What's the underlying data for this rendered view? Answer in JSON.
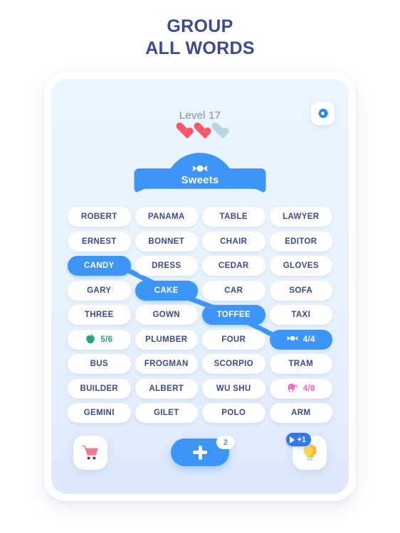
{
  "page": {
    "title_line1": "GROUP",
    "title_line2": "ALL WORDS",
    "title_color": "#3e4a89"
  },
  "header": {
    "level_label": "Level 17",
    "lives_total": 3,
    "lives_remaining": 2,
    "heart_full_color": "#f8566a",
    "heart_empty_color": "#b6d7e2",
    "settings_icon": "gear-icon"
  },
  "banner": {
    "category": "Sweets",
    "icon": "candy-icon",
    "color": "#3d95f7"
  },
  "grid": {
    "rows": [
      [
        {
          "label": "ROBERT",
          "type": "word",
          "selected": false
        },
        {
          "label": "PANAMA",
          "type": "word",
          "selected": false
        },
        {
          "label": "TABLE",
          "type": "word",
          "selected": false
        },
        {
          "label": "LAWYER",
          "type": "word",
          "selected": false
        }
      ],
      [
        {
          "label": "ERNEST",
          "type": "word",
          "selected": false
        },
        {
          "label": "BONNET",
          "type": "word",
          "selected": false
        },
        {
          "label": "CHAIR",
          "type": "word",
          "selected": false
        },
        {
          "label": "EDITOR",
          "type": "word",
          "selected": false
        }
      ],
      [
        {
          "label": "CANDY",
          "type": "word",
          "selected": true
        },
        {
          "label": "DRESS",
          "type": "word",
          "selected": false
        },
        {
          "label": "CEDAR",
          "type": "word",
          "selected": false
        },
        {
          "label": "GLOVES",
          "type": "word",
          "selected": false
        }
      ],
      [
        {
          "label": "GARY",
          "type": "word",
          "selected": false
        },
        {
          "label": "CAKE",
          "type": "word",
          "selected": true
        },
        {
          "label": "CAR",
          "type": "word",
          "selected": false
        },
        {
          "label": "SOFA",
          "type": "word",
          "selected": false
        }
      ],
      [
        {
          "label": "THREE",
          "type": "word",
          "selected": false
        },
        {
          "label": "GOWN",
          "type": "word",
          "selected": false
        },
        {
          "label": "TOFFEE",
          "type": "word",
          "selected": true
        },
        {
          "label": "TAXI",
          "type": "word",
          "selected": false
        }
      ],
      [
        {
          "label": "5/6",
          "type": "counter",
          "icon": "apple-icon",
          "theme": "apple",
          "selected": false
        },
        {
          "label": "PLUMBER",
          "type": "word",
          "selected": false
        },
        {
          "label": "FOUR",
          "type": "word",
          "selected": false
        },
        {
          "label": "4/4",
          "type": "counter",
          "icon": "candy-icon",
          "theme": "candy-done",
          "selected": true
        }
      ],
      [
        {
          "label": "BUS",
          "type": "word",
          "selected": false
        },
        {
          "label": "FROGMAN",
          "type": "word",
          "selected": false
        },
        {
          "label": "SCORPIO",
          "type": "word",
          "selected": false
        },
        {
          "label": "TRAM",
          "type": "word",
          "selected": false
        }
      ],
      [
        {
          "label": "BUILDER",
          "type": "word",
          "selected": false
        },
        {
          "label": "ALBERT",
          "type": "word",
          "selected": false
        },
        {
          "label": "WU SHU",
          "type": "word",
          "selected": false
        },
        {
          "label": "4/8",
          "type": "counter",
          "icon": "elephant-icon",
          "theme": "elephant",
          "selected": false
        }
      ],
      [
        {
          "label": "GEMINI",
          "type": "word",
          "selected": false
        },
        {
          "label": "GILET",
          "type": "word",
          "selected": false
        },
        {
          "label": "POLO",
          "type": "word",
          "selected": false
        },
        {
          "label": "ARM",
          "type": "word",
          "selected": false
        }
      ]
    ],
    "selection_chain": [
      "CANDY",
      "CAKE",
      "TOFFEE",
      "4/4"
    ],
    "selected_color": "#3d95f7"
  },
  "bottom_bar": {
    "shop_icon": "shopping-cart-icon",
    "add_icon": "plus-icon",
    "add_badge": "2",
    "hint_icon": "lightbulb-icon",
    "hint_badge": "+1",
    "hint_badge_icon": "play-icon"
  }
}
